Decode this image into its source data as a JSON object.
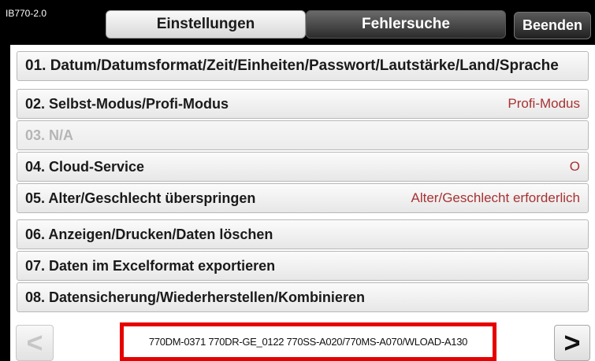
{
  "device": {
    "model": "IB770-2.0"
  },
  "tabs": [
    {
      "label": "Einstellungen",
      "active": true
    },
    {
      "label": "Fehlersuche",
      "active": false
    }
  ],
  "exit_label": "Beenden",
  "menu_items": [
    {
      "label": "01. Datum/Datumsformat/Zeit/Einheiten/Passwort/Lautstärke/Land/Sprache",
      "value": ""
    },
    {
      "label": "02. Selbst-Modus/Profi-Modus",
      "value": "Profi-Modus"
    },
    {
      "label": "03. N/A",
      "value": "",
      "disabled": true
    },
    {
      "label": "04. Cloud-Service",
      "value": "O"
    },
    {
      "label": "05. Alter/Geschlecht überspringen",
      "value": "Alter/Geschlecht erforderlich"
    },
    {
      "label": "06. Anzeigen/Drucken/Daten löschen",
      "value": ""
    },
    {
      "label": "07. Daten im Excelformat exportieren",
      "value": ""
    },
    {
      "label": "08. Datensicherung/Wiederherstellen/Kombinieren",
      "value": ""
    }
  ],
  "footer": {
    "prev_glyph": "<",
    "next_glyph": ">",
    "version_text": "770DM-0371 770DR-GE_0122 770SS-A020/770MS-A070/WLOAD-A130"
  },
  "colors": {
    "value_text": "#a83232",
    "highlight_border": "#e60000",
    "background": "#000000"
  }
}
